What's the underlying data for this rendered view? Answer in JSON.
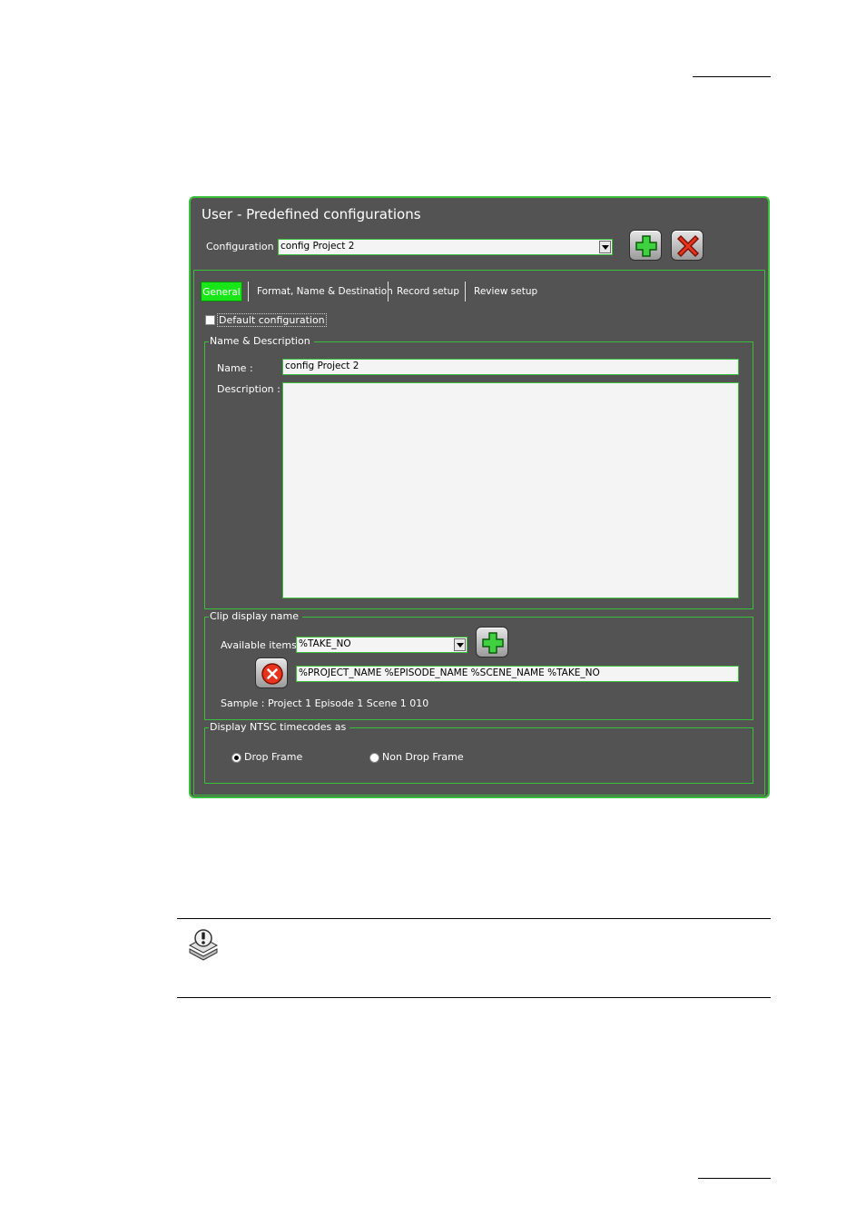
{
  "dialog": {
    "title": "User - Predefined configurations",
    "configuration_label": "Configuration :",
    "configuration_value": "config Project 2",
    "add_icon": "plus-icon",
    "delete_icon": "x-icon",
    "accent_color": "#3bbf3b",
    "active_tab_color": "#19e619"
  },
  "tabs": [
    {
      "label": "General",
      "active": true
    },
    {
      "label": "Format, Name & Destination",
      "active": false
    },
    {
      "label": "Record setup",
      "active": false
    },
    {
      "label": "Review setup",
      "active": false
    }
  ],
  "general": {
    "default_config_label": "Default configuration",
    "default_config_checked": false,
    "name_group": {
      "legend": "Name & Description",
      "name_label": "Name :",
      "name_value": "config Project 2",
      "description_label": "Description :",
      "description_value": ""
    },
    "clip_group": {
      "legend": "Clip display name",
      "available_items_label": "Available items:",
      "available_items_value": "%TAKE_NO",
      "pattern_value": "%PROJECT_NAME %EPISODE_NAME %SCENE_NAME %TAKE_NO",
      "sample_text": "Sample : Project 1 Episode 1 Scene 1 010"
    },
    "ntsc_group": {
      "legend": "Display NTSC timecodes as",
      "options": [
        {
          "label": "Drop Frame",
          "selected": true
        },
        {
          "label": "Non Drop Frame",
          "selected": false
        }
      ]
    }
  },
  "note": {
    "icon": "note-icon"
  }
}
